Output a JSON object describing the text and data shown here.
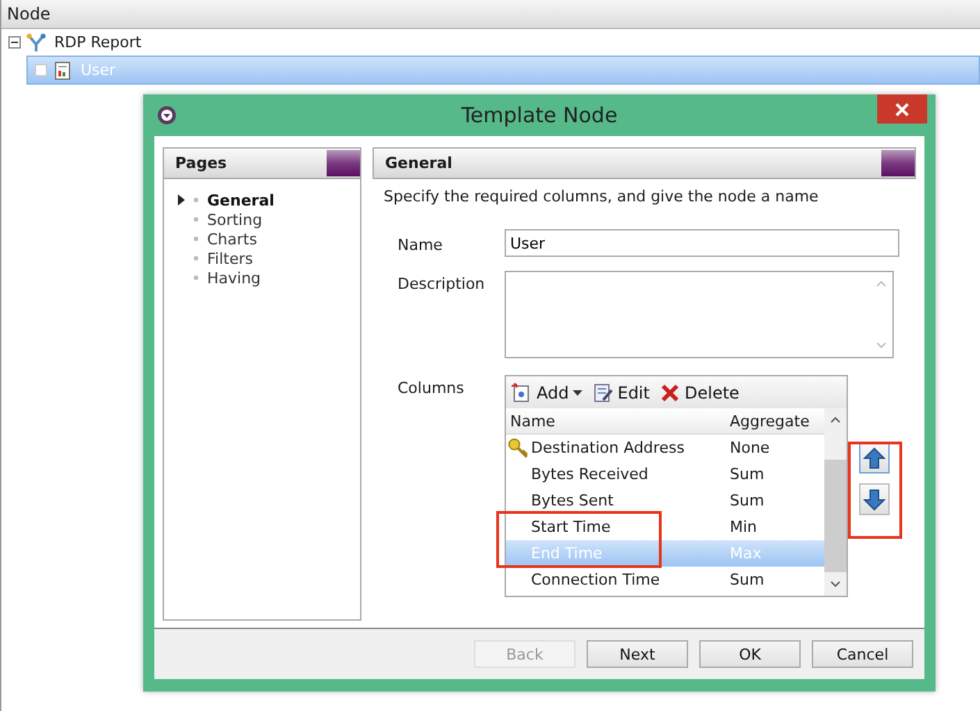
{
  "tree": {
    "column": "Node",
    "nodes": [
      {
        "label": "RDP Report",
        "expanded": true,
        "selected": false,
        "children": [
          {
            "label": "User",
            "expanded": false,
            "selected": true
          }
        ]
      }
    ]
  },
  "dialog": {
    "title": "Template Node",
    "pages": {
      "title": "Pages",
      "items": [
        {
          "label": "General",
          "selected": true
        },
        {
          "label": "Sorting",
          "selected": false
        },
        {
          "label": "Charts",
          "selected": false
        },
        {
          "label": "Filters",
          "selected": false
        },
        {
          "label": "Having",
          "selected": false
        }
      ]
    },
    "section": {
      "title": "General",
      "hint": "Specify the required columns, and give the node a name",
      "name_label": "Name",
      "name_value": "User",
      "description_label": "Description",
      "columns_label": "Columns",
      "toolbar": [
        "Add",
        "Edit",
        "Delete"
      ],
      "columns": {
        "headers": [
          "Name",
          "Aggregate"
        ],
        "rows": [
          {
            "name": "Destination Address",
            "aggregate": "None",
            "key": true,
            "selected": false
          },
          {
            "name": "Bytes Received",
            "aggregate": "Sum",
            "key": false,
            "selected": false
          },
          {
            "name": "Bytes Sent",
            "aggregate": "Sum",
            "key": false,
            "selected": false
          },
          {
            "name": "Start Time",
            "aggregate": "Min",
            "key": false,
            "selected": false
          },
          {
            "name": "End Time",
            "aggregate": "Max",
            "key": false,
            "selected": true
          },
          {
            "name": "Connection Time",
            "aggregate": "Sum",
            "key": false,
            "selected": false
          }
        ]
      }
    },
    "buttons": [
      {
        "label": "Back",
        "disabled": true
      },
      {
        "label": "Next",
        "disabled": false
      },
      {
        "label": "OK",
        "disabled": false
      },
      {
        "label": "Cancel",
        "disabled": false
      }
    ]
  }
}
